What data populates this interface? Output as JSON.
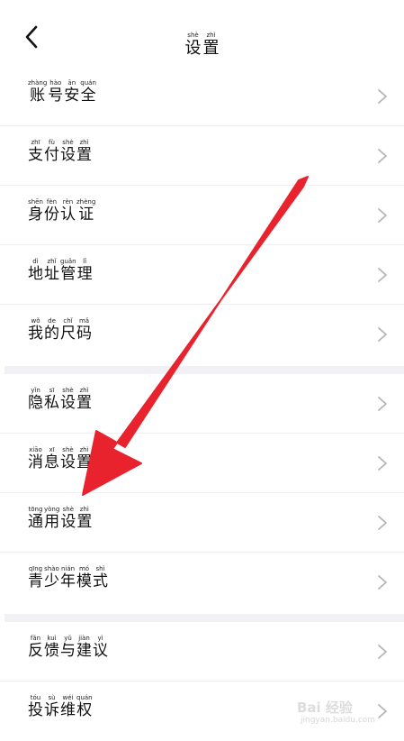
{
  "header": {
    "title": [
      {
        "hz": "设",
        "py": "shè"
      },
      {
        "hz": "置",
        "py": "zhì"
      }
    ],
    "back_icon": "chevron-left-icon"
  },
  "groups": [
    {
      "items": [
        {
          "key": "account-security",
          "chars": [
            {
              "hz": "账",
              "py": "zhàng"
            },
            {
              "hz": "号",
              "py": "hào"
            },
            {
              "hz": "安",
              "py": "ān"
            },
            {
              "hz": "全",
              "py": "quán"
            }
          ]
        },
        {
          "key": "payment-settings",
          "chars": [
            {
              "hz": "支",
              "py": "zhī"
            },
            {
              "hz": "付",
              "py": "fù"
            },
            {
              "hz": "设",
              "py": "shè"
            },
            {
              "hz": "置",
              "py": "zhì"
            }
          ]
        },
        {
          "key": "identity-verification",
          "chars": [
            {
              "hz": "身",
              "py": "shēn"
            },
            {
              "hz": "份",
              "py": "fèn"
            },
            {
              "hz": "认",
              "py": "rèn"
            },
            {
              "hz": "证",
              "py": "zhèng"
            }
          ]
        },
        {
          "key": "address-management",
          "chars": [
            {
              "hz": "地",
              "py": "dì"
            },
            {
              "hz": "址",
              "py": "zhǐ"
            },
            {
              "hz": "管",
              "py": "guǎn"
            },
            {
              "hz": "理",
              "py": "lǐ"
            }
          ]
        },
        {
          "key": "my-size",
          "chars": [
            {
              "hz": "我",
              "py": "wǒ"
            },
            {
              "hz": "的",
              "py": "de"
            },
            {
              "hz": "尺",
              "py": "chǐ"
            },
            {
              "hz": "码",
              "py": "mǎ"
            }
          ]
        }
      ]
    },
    {
      "items": [
        {
          "key": "privacy-settings",
          "chars": [
            {
              "hz": "隐",
              "py": "yǐn"
            },
            {
              "hz": "私",
              "py": "sī"
            },
            {
              "hz": "设",
              "py": "shè"
            },
            {
              "hz": "置",
              "py": "zhì"
            }
          ]
        },
        {
          "key": "message-settings",
          "chars": [
            {
              "hz": "消",
              "py": "xiāo"
            },
            {
              "hz": "息",
              "py": "xī"
            },
            {
              "hz": "设",
              "py": "shè"
            },
            {
              "hz": "置",
              "py": "zhì"
            }
          ]
        },
        {
          "key": "general-settings",
          "chars": [
            {
              "hz": "通",
              "py": "tōng"
            },
            {
              "hz": "用",
              "py": "yòng"
            },
            {
              "hz": "设",
              "py": "shè"
            },
            {
              "hz": "置",
              "py": "zhì"
            }
          ]
        },
        {
          "key": "teen-mode",
          "chars": [
            {
              "hz": "青",
              "py": "qīng"
            },
            {
              "hz": "少",
              "py": "shào"
            },
            {
              "hz": "年",
              "py": "nián"
            },
            {
              "hz": "模",
              "py": "mó"
            },
            {
              "hz": "式",
              "py": "shì"
            }
          ]
        }
      ]
    },
    {
      "items": [
        {
          "key": "feedback",
          "chars": [
            {
              "hz": "反",
              "py": "fǎn"
            },
            {
              "hz": "馈",
              "py": "kuì"
            },
            {
              "hz": "与",
              "py": "yǔ"
            },
            {
              "hz": "建",
              "py": "jiàn"
            },
            {
              "hz": "议",
              "py": "yì"
            }
          ]
        },
        {
          "key": "complaint-rights",
          "chars": [
            {
              "hz": "投",
              "py": "tóu"
            },
            {
              "hz": "诉",
              "py": "sù"
            },
            {
              "hz": "维",
              "py": "wéi"
            },
            {
              "hz": "权",
              "py": "quán"
            }
          ]
        }
      ]
    }
  ],
  "row_chevron_icon": "chevron-right-icon",
  "annotation": {
    "arrow_color": "#e8232e",
    "arrow_icon": "red-arrow-annotation"
  },
  "watermark": {
    "text": "Bai 经验",
    "sub": "jingyan.baidu.com"
  },
  "colors": {
    "background": "#ffffff",
    "separator": "#f1f1f5",
    "divider": "#efeff3",
    "chevron": "#b5b5b8",
    "text": "#111111"
  }
}
